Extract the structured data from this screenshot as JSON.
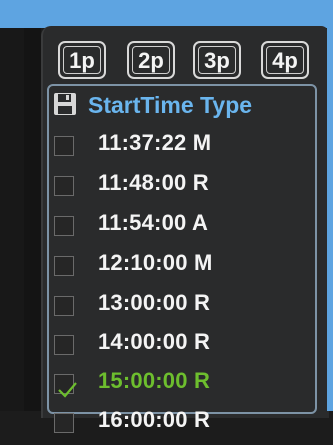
{
  "tabs": [
    {
      "label": "1p",
      "active": true
    },
    {
      "label": "2p",
      "active": false
    },
    {
      "label": "3p",
      "active": false
    },
    {
      "label": "4p",
      "active": false
    }
  ],
  "list_header": {
    "title": "StartTime Type",
    "icon": "save-icon"
  },
  "rows": [
    {
      "text": "11:37:22 M",
      "checked": false
    },
    {
      "text": "11:48:00 R",
      "checked": false
    },
    {
      "text": "11:54:00 A",
      "checked": false
    },
    {
      "text": "12:10:00 M",
      "checked": false
    },
    {
      "text": "13:00:00 R",
      "checked": false
    },
    {
      "text": "14:00:00 R",
      "checked": false
    },
    {
      "text": "15:00:00 R",
      "checked": true
    },
    {
      "text": "16:00:00 R",
      "checked": false
    }
  ],
  "colors": {
    "accent": "#5ea4e1",
    "header_text": "#6ab5ee",
    "selected_text": "#6dbe2e",
    "panel_bg": "#2a2b2c"
  }
}
